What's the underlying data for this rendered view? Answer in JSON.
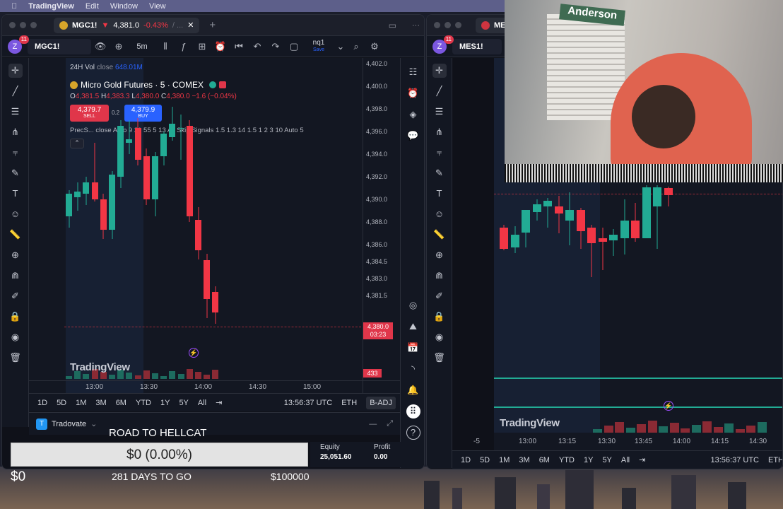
{
  "menubar": {
    "app": "TradingView",
    "items": [
      "Edit",
      "Window",
      "View"
    ]
  },
  "left_window": {
    "tab": {
      "symbol": "MGC1!",
      "arrow": "▼",
      "price": "4,381.0",
      "change": "-0.43%",
      "rest": "/ ..."
    },
    "toolbar": {
      "avatar": "Z",
      "badge": "11",
      "symbol": "MGC1!",
      "interval": "5m",
      "watchlist": "nq1",
      "watchlist_sub": "Save"
    },
    "legend": {
      "vol_label": "24H Vol",
      "vol_close": "close",
      "vol_value": "648.01M",
      "title": "Micro Gold Futures · 5 · COMEX",
      "ohlc": {
        "o_label": "O",
        "o": "4,381.5",
        "h_label": "H",
        "h": "4,383.3",
        "l_label": "L",
        "l": "4,380.0",
        "c_label": "C",
        "c": "4,380.0",
        "chg": "−1.6 (−0.04%)"
      },
      "sell_price": "4,379.7",
      "sell_label": "SELL",
      "spread": "0.2",
      "buy_price": "4,379.9",
      "buy_label": "BUY",
      "indicator": "PrecS... close Auto 9 21 55 5 13 All Skip Signals 1.5 1.3 14 1.5 1 2 3 10 Auto 5"
    },
    "price_scale": [
      "4,402.0",
      "4,400.0",
      "4,398.0",
      "4,396.0",
      "4,394.0",
      "4,392.0",
      "4,390.0",
      "4,388.0",
      "4,386.0",
      "4,384.5",
      "4,383.0",
      "4,381.5",
      "4,378.4"
    ],
    "last_price": "4,380.0",
    "countdown": "03:23",
    "volume_tag": "433",
    "time_axis": [
      "13:00",
      "13:30",
      "14:00",
      "14:30",
      "15:00"
    ],
    "ranges": [
      "1D",
      "5D",
      "1M",
      "3M",
      "6M",
      "YTD",
      "1Y",
      "5Y",
      "All"
    ],
    "clock": "13:56:37 UTC",
    "session": "ETH",
    "badj": "B-ADJ",
    "watermark": "TradingView",
    "broker": {
      "name": "Tradovate",
      "equity_label": "Equity",
      "equity": "25,051.60",
      "profit_label": "Profit",
      "profit": "0.00"
    }
  },
  "right_window": {
    "toolbar": {
      "avatar": "Z",
      "badge": "11",
      "symbol": "MES1!",
      "tab": "MES1"
    },
    "time_axis": [
      "-5",
      "13:00",
      "13:15",
      "13:30",
      "13:45",
      "14:00",
      "14:15",
      "14:30"
    ],
    "ranges": [
      "1D",
      "5D",
      "1M",
      "3M",
      "6M",
      "YTD",
      "1Y",
      "5Y",
      "All"
    ],
    "clock": "13:56:37 UTC",
    "session": "ETH",
    "watermark": "TradingView"
  },
  "overlay": {
    "title": "ROAD TO HELLCAT",
    "progress_text": "$0 (0.00%)",
    "progress_fraction": 0.0,
    "start": "$0",
    "days": "281 DAYS TO GO",
    "goal": "$100000"
  },
  "webcam": {
    "sign": "Anderson"
  },
  "chart_data": {
    "type": "candlestick",
    "symbol": "MGC1!",
    "candles": [
      {
        "o": 4388.5,
        "h": 4390.8,
        "l": 4387.5,
        "c": 4390.5
      },
      {
        "o": 4390.2,
        "h": 4391.5,
        "l": 4389.0,
        "c": 4390.7
      },
      {
        "o": 4390.5,
        "h": 4392.0,
        "l": 4389.5,
        "c": 4391.5
      },
      {
        "o": 4391.5,
        "h": 4395.0,
        "l": 4389.8,
        "c": 4390.0
      },
      {
        "o": 4390.0,
        "h": 4390.5,
        "l": 4386.5,
        "c": 4387.3
      },
      {
        "o": 4387.3,
        "h": 4392.5,
        "l": 4386.5,
        "c": 4392.2
      },
      {
        "o": 4392.0,
        "h": 4397.0,
        "l": 4391.0,
        "c": 4396.5
      },
      {
        "o": 4395.0,
        "h": 4397.0,
        "l": 4394.0,
        "c": 4395.3
      },
      {
        "o": 4396.3,
        "h": 4397.2,
        "l": 4393.0,
        "c": 4393.5
      },
      {
        "o": 4393.8,
        "h": 4394.5,
        "l": 4389.5,
        "c": 4390.0
      },
      {
        "o": 4390.0,
        "h": 4394.2,
        "l": 4388.5,
        "c": 4393.8
      },
      {
        "o": 4393.8,
        "h": 4396.0,
        "l": 4393.0,
        "c": 4395.8
      },
      {
        "o": 4395.5,
        "h": 4398.2,
        "l": 4395.2,
        "c": 4396.7
      },
      {
        "o": 4396.3,
        "h": 4397.5,
        "l": 4393.5,
        "c": 4396.3
      },
      {
        "o": 4396.5,
        "h": 4397.0,
        "l": 4388.0,
        "c": 4388.5
      },
      {
        "o": 4388.2,
        "h": 4389.3,
        "l": 4384.7,
        "c": 4385.5
      },
      {
        "o": 4384.6,
        "h": 4385.2,
        "l": 4379.5,
        "c": 4381.2
      },
      {
        "o": 4381.8,
        "h": 4382.3,
        "l": 4379.0,
        "c": 4380.0
      }
    ],
    "ylim": [
      4377.5,
      4402.5
    ]
  }
}
